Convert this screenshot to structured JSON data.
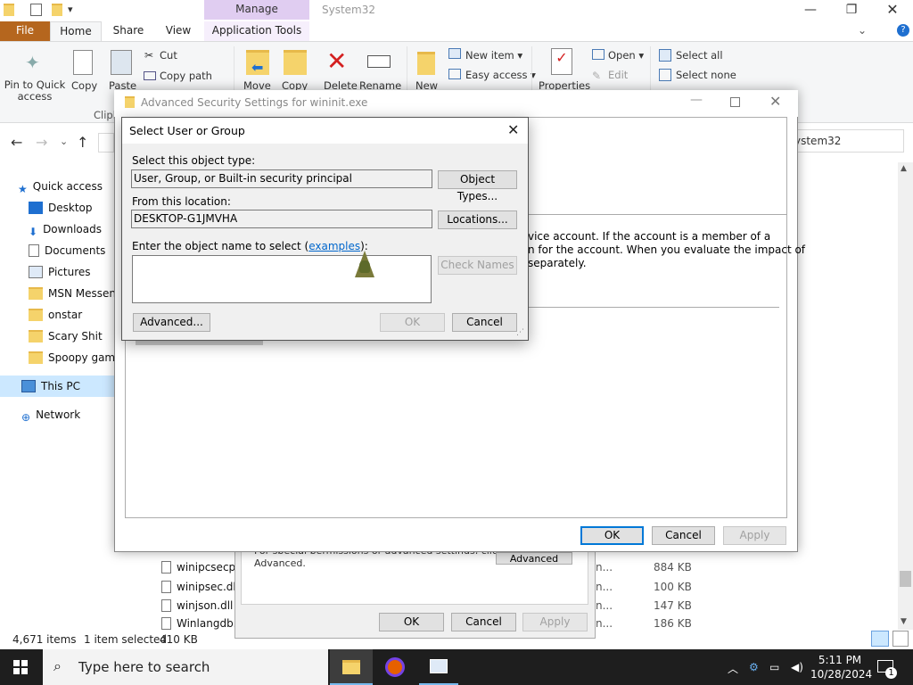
{
  "explorer": {
    "title": "System32",
    "manage_tab": "Manage",
    "tabs": {
      "file": "File",
      "home": "Home",
      "share": "Share",
      "view": "View",
      "app_tools": "Application Tools"
    },
    "ribbon": {
      "pin": "Pin to Quick\naccess",
      "copy": "Copy",
      "paste": "Paste",
      "cut": "Cut",
      "copy_path": "Copy path",
      "clipboard_group": "Clipb",
      "move": "Move",
      "copy_to": "Copy",
      "delete": "Delete",
      "rename": "Rename",
      "new": "New",
      "new_item": "New item",
      "easy_access": "Easy access",
      "properties": "Properties",
      "open": "Open",
      "edit": "Edit",
      "select_all": "Select all",
      "select_none": "Select none"
    },
    "address_text": "ystem32",
    "nav": {
      "quick_access": "Quick access",
      "desktop": "Desktop",
      "downloads": "Downloads",
      "documents": "Documents",
      "pictures": "Pictures",
      "msn": "MSN Messeng",
      "onstar": "onstar",
      "scary": "Scary Shit",
      "spoopy": "Spoopy games",
      "this_pc": "This PC",
      "network": "Network"
    },
    "files": [
      {
        "name": "winipcsecpro",
        "n": "n...",
        "size": "884 KB"
      },
      {
        "name": "winipsec.dll",
        "n": "n...",
        "size": "100 KB"
      },
      {
        "name": "winjson.dll",
        "n": "n...",
        "size": "147 KB"
      },
      {
        "name": "Winlangdb.c",
        "n": "n...",
        "size": "186 KB"
      }
    ],
    "status": {
      "items": "4,671 items",
      "selected": "1 item selected",
      "size": "410 KB"
    }
  },
  "props_dialog": {
    "hint": "Advanced.",
    "hint_partial": "For special permissions or advanced settings, click",
    "advanced_btn": "Advanced",
    "ok": "OK",
    "cancel": "Cancel",
    "apply": "Apply"
  },
  "adv_security": {
    "title": "Advanced Security Settings for wininit.exe",
    "desc_line1": "vice account. If the account is a member of a",
    "desc_line2": "n for the account. When you evaluate the impact of",
    "desc_line3": "separately.",
    "ok": "OK",
    "cancel": "Cancel",
    "apply": "Apply"
  },
  "select_user": {
    "title": "Select User or Group",
    "object_type_label": "Select this object type:",
    "object_type_value": "User, Group, or Built-in security principal",
    "object_types_btn": "Object Types...",
    "location_label": "From this location:",
    "location_value": "DESKTOP-G1JMVHA",
    "locations_btn": "Locations...",
    "enter_label_pre": "Enter the object name to select (",
    "examples_link": "examples",
    "enter_label_post": "):",
    "check_names_btn": "Check Names",
    "advanced_btn": "Advanced...",
    "ok_btn": "OK",
    "cancel_btn": "Cancel"
  },
  "taskbar": {
    "search_placeholder": "Type here to search",
    "time": "5:11 PM",
    "date": "10/28/2024",
    "notif_count": "1"
  },
  "colors": {
    "accent": "#0078d7",
    "file_tab": "#b5661e",
    "manage": "#e0cdf1",
    "taskbar": "#1e1e1e"
  }
}
